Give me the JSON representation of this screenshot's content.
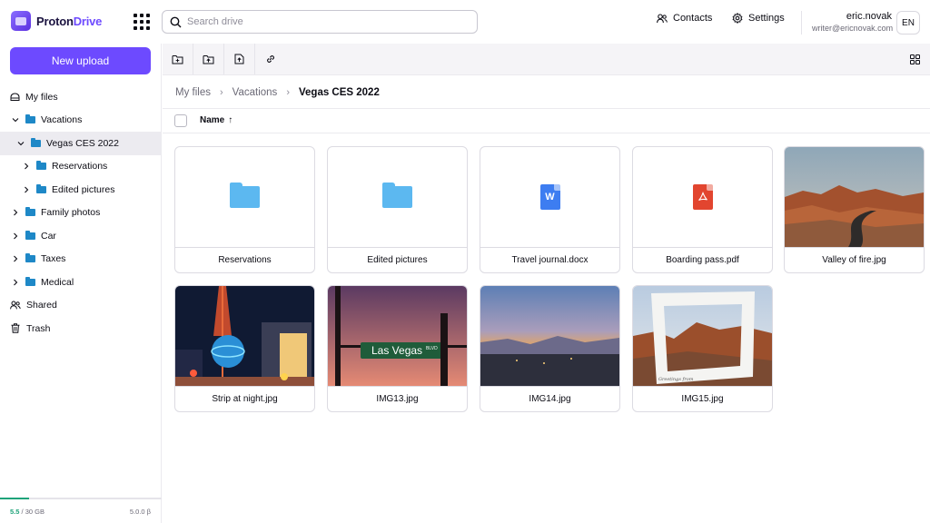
{
  "app": {
    "name_part1": "Proton",
    "name_part2": "Drive",
    "brand_color": "#6d4aff"
  },
  "search": {
    "placeholder": "Search drive"
  },
  "header": {
    "contacts_label": "Contacts",
    "settings_label": "Settings",
    "user_name": "eric.novak",
    "user_email": "writer@ericnovak.com",
    "language": "EN"
  },
  "sidebar": {
    "upload_label": "New upload",
    "items": [
      {
        "label": "My files",
        "icon": "cloud-icon"
      },
      {
        "label": "Vacations",
        "icon": "folder-icon",
        "expanded": true
      },
      {
        "label": "Vegas CES 2022",
        "icon": "folder-icon",
        "expanded": true,
        "active": true
      },
      {
        "label": "Reservations",
        "icon": "folder-icon"
      },
      {
        "label": "Edited pictures",
        "icon": "folder-icon"
      },
      {
        "label": "Family photos",
        "icon": "folder-icon"
      },
      {
        "label": "Car",
        "icon": "folder-icon"
      },
      {
        "label": "Taxes",
        "icon": "folder-icon"
      },
      {
        "label": "Medical",
        "icon": "folder-icon"
      },
      {
        "label": "Shared",
        "icon": "users-icon"
      },
      {
        "label": "Trash",
        "icon": "trash-icon"
      }
    ],
    "storage": {
      "used": "5.5",
      "total": "/ 30 GB",
      "version": "5.0.0 β",
      "fraction": 0.18
    }
  },
  "breadcrumb": {
    "root": "My files",
    "parent": "Vacations",
    "current": "Vegas CES 2022"
  },
  "list_header": {
    "sort_label": "Name",
    "sort_dir": "↑"
  },
  "items": [
    {
      "name": "Reservations",
      "type": "folder"
    },
    {
      "name": "Edited pictures",
      "type": "folder"
    },
    {
      "name": "Travel journal.docx",
      "type": "docx",
      "badge": "W",
      "color": "#3d7df1"
    },
    {
      "name": "Boarding pass.pdf",
      "type": "pdf",
      "color": "#e2452f"
    },
    {
      "name": "Valley of fire.jpg",
      "type": "image"
    },
    {
      "name": "Strip at night.jpg",
      "type": "image"
    },
    {
      "name": "IMG13.jpg",
      "type": "image",
      "sign_text": "Las Vegas",
      "sign_small": "BLVD"
    },
    {
      "name": "IMG14.jpg",
      "type": "image"
    },
    {
      "name": "IMG15.jpg",
      "type": "image",
      "caption_text": "Greetings from"
    }
  ]
}
